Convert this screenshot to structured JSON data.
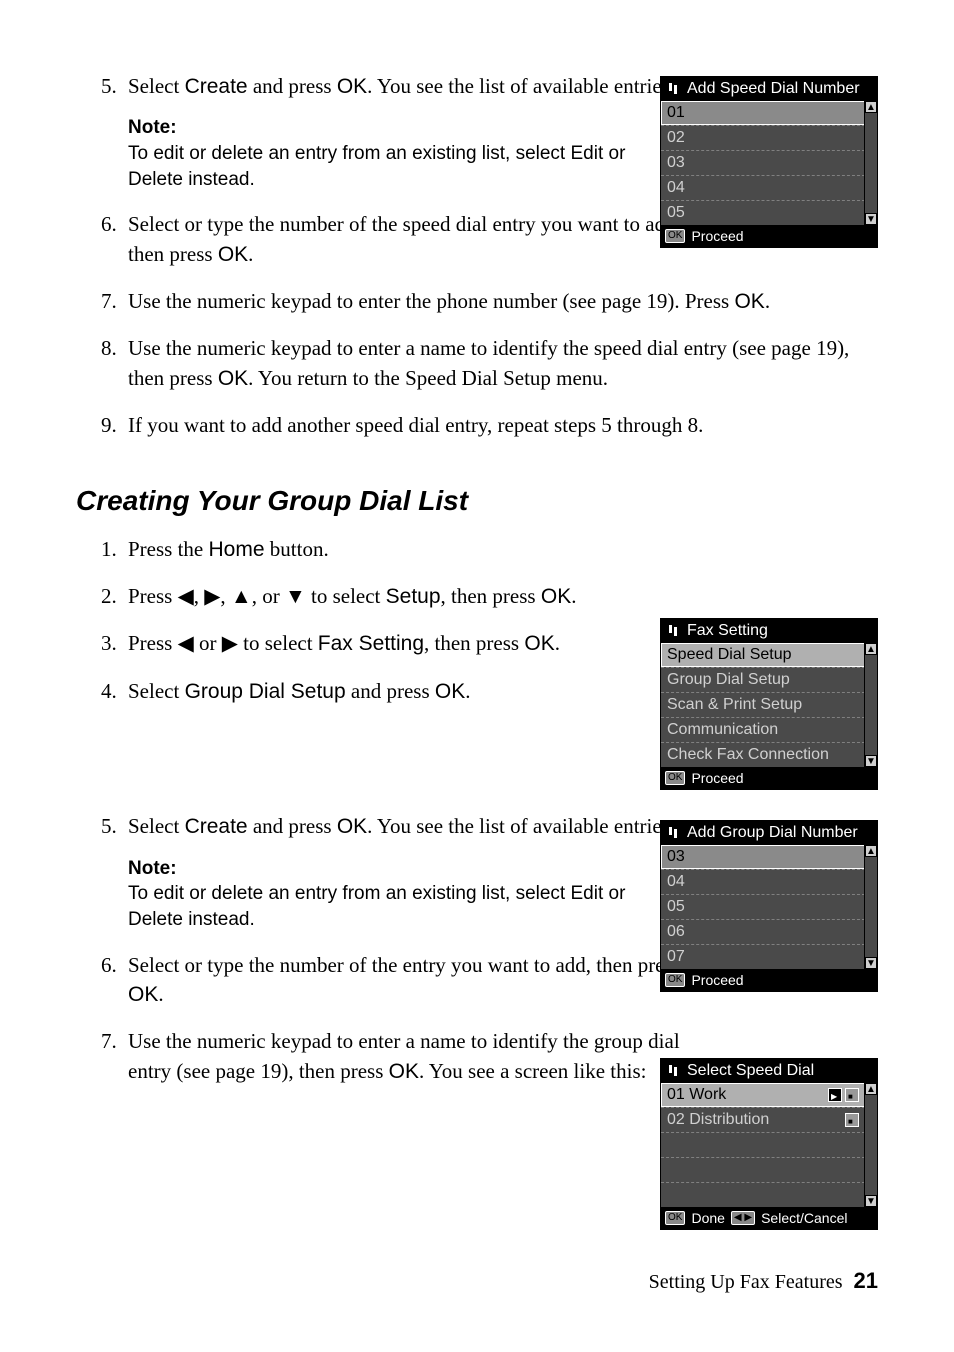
{
  "steps_a": {
    "n5": "5.",
    "s5_a": "Select ",
    "s5_b": "Create",
    "s5_c": " and press ",
    "s5_d": "OK",
    "s5_e": ". You see the list of available entries.",
    "note_h": "Note:",
    "note_a": "To edit or delete an entry from an existing list, select ",
    "note_b": "Edit",
    "note_c": " or ",
    "note_d": "Delete",
    "note_e": " instead.",
    "n6": "6.",
    "s6_a": "Select or type the number of the speed dial entry you want to add, then press ",
    "s6_b": "OK",
    "s6_c": ".",
    "n7": "7.",
    "s7_a": "Use the numeric keypad to enter the phone number (see page 19). Press ",
    "s7_b": "OK",
    "s7_c": ".",
    "n8": "8.",
    "s8_a": "Use the numeric keypad to enter a name to identify the speed dial entry (see page 19), then press ",
    "s8_b": "OK",
    "s8_c": ". You return to the Speed Dial Setup menu.",
    "n9": "9.",
    "s9": "If you want to add another speed dial entry, repeat steps 5 through 8."
  },
  "heading": "Creating Your Group Dial List",
  "steps_b": {
    "n1": "1.",
    "s1_a": "Press the ",
    "s1_b": "Home",
    "s1_c": " button.",
    "n2": "2.",
    "s2_a": "Press ",
    "s2_b": ", or ",
    "s2_c": " to select ",
    "s2_d": "Setup",
    "s2_e": ", then press ",
    "s2_f": "OK",
    "s2_g": ".",
    "arrows": {
      "l": "◀",
      "r": "▶",
      "u": "▲",
      "d": "▼",
      "sep": ", "
    },
    "n3": "3.",
    "s3_a": "Press ",
    "s3_b": " or ",
    "s3_c": " to select ",
    "s3_d": "Fax Setting",
    "s3_e": ", then press ",
    "s3_f": "OK",
    "s3_g": ".",
    "n4": "4.",
    "s4_a": "Select ",
    "s4_b": "Group Dial Setup",
    "s4_c": " and press ",
    "s4_d": "OK",
    "s4_e": ".",
    "n5": "5.",
    "s5_a": "Select ",
    "s5_b": "Create",
    "s5_c": " and press ",
    "s5_d": "OK",
    "s5_e": ". You see the list of available entries.",
    "note_h": "Note:",
    "note_a": "To edit or delete an entry from an existing list, select ",
    "note_b": "Edit",
    "note_c": " or ",
    "note_d": "Delete",
    "note_e": " instead.",
    "n6": "6.",
    "s6_a": "Select or type the number of the entry you want to add, then press ",
    "s6_b": "OK",
    "s6_c": ".",
    "n7": "7.",
    "s7_a": "Use the numeric keypad to enter a name to identify the group dial entry (see page 19), then press ",
    "s7_b": "OK",
    "s7_c": ". You see a screen like this:"
  },
  "lcd1": {
    "title": "Add Speed Dial Number",
    "rows": [
      "01",
      "02",
      "03",
      "04",
      "05"
    ],
    "footer_btn": "OK",
    "footer": "Proceed"
  },
  "lcd2": {
    "title": "Fax Setting",
    "rows": [
      "Speed Dial Setup",
      "Group Dial Setup",
      "Scan & Print Setup",
      "Communication",
      "Check Fax Connection"
    ],
    "footer_btn": "OK",
    "footer": "Proceed"
  },
  "lcd3": {
    "title": "Add Group Dial Number",
    "rows": [
      "03",
      "04",
      "05",
      "06",
      "07"
    ],
    "footer_btn": "OK",
    "footer": "Proceed"
  },
  "lcd4": {
    "title": "Select Speed Dial",
    "rows": [
      {
        "label": "01 Work",
        "selected": true
      },
      {
        "label": "02 Distribution",
        "selected": false
      },
      {
        "label": "",
        "selected": false
      },
      {
        "label": "",
        "selected": false
      },
      {
        "label": "",
        "selected": false
      }
    ],
    "footer_btn": "OK",
    "footer_a": "Done",
    "footer_lr": "◀ ▶",
    "footer_b": "Select/Cancel"
  },
  "footer": {
    "section": "Setting Up Fax Features",
    "page": "21"
  }
}
